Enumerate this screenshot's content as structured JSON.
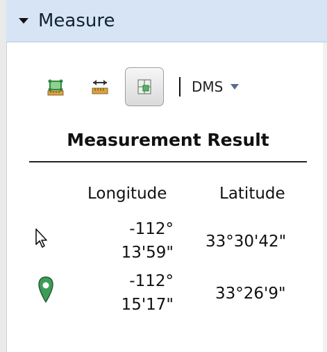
{
  "header": {
    "title": "Measure"
  },
  "toolbar": {
    "tools": [
      {
        "name": "area-measure-icon",
        "active": false
      },
      {
        "name": "distance-measure-icon",
        "active": false
      },
      {
        "name": "location-measure-icon",
        "active": true
      }
    ],
    "unit": "DMS"
  },
  "result": {
    "title": "Measurement Result",
    "columns": [
      "Longitude",
      "Latitude"
    ],
    "rows": [
      {
        "icon": "cursor-arrow-icon",
        "lon_line1": "-112°",
        "lon_line2": "13'59\"",
        "lat": "33°30'42\""
      },
      {
        "icon": "map-pin-icon",
        "lon_line1": "-112°",
        "lon_line2": "15'17\"",
        "lat": "33°26'9\""
      }
    ]
  },
  "colors": {
    "header_bg": "#d7e4f5",
    "pin_green": "#3f9b58",
    "ruler_tan": "#d9a441"
  }
}
